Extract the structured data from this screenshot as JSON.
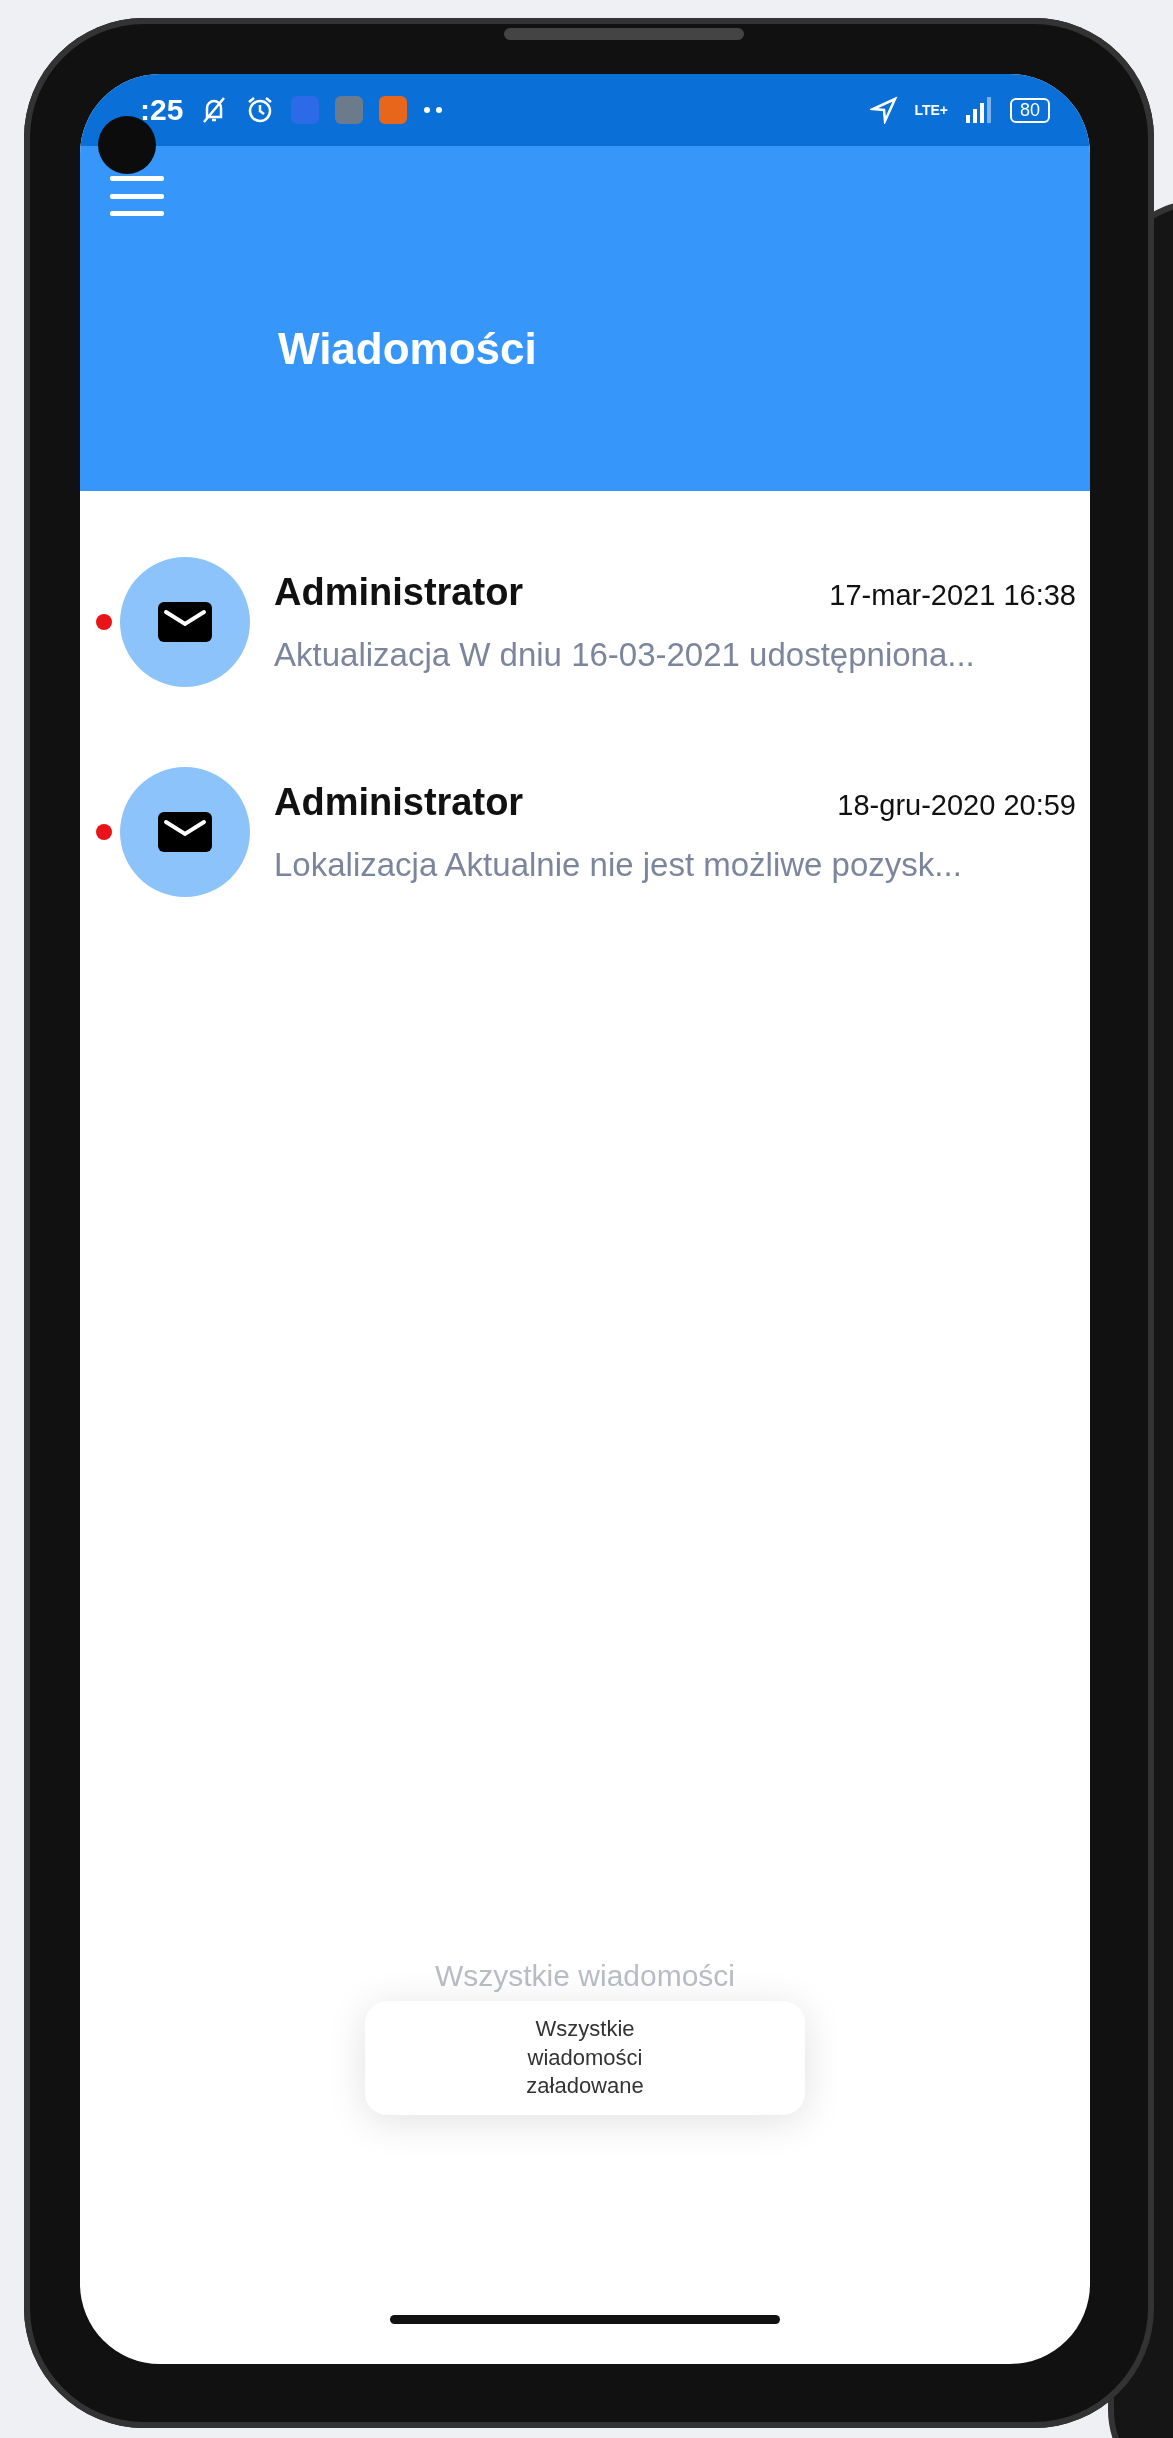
{
  "status_bar": {
    "time": ":25",
    "network": "LTE+",
    "battery": "80"
  },
  "header": {
    "title": "Wiadomości"
  },
  "messages": [
    {
      "sender": "Administrator",
      "date": "17-mar-2021 16:38",
      "preview": "Aktualizacja W dniu 16-03-2021 udostępniona...",
      "unread": true
    },
    {
      "sender": "Administrator",
      "date": "18-gru-2020 20:59",
      "preview": "Lokalizacja Aktualnie nie jest możliwe pozysk...",
      "unread": true
    }
  ],
  "footer_text": "Wszystkie wiadomości",
  "toast": "Wszystkie wiadomości załadowane"
}
